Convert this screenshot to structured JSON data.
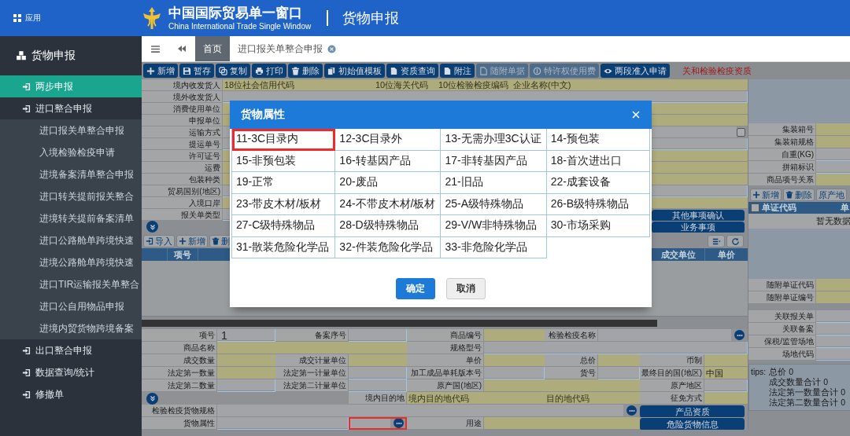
{
  "header": {
    "app_menu": "应用",
    "title": "中国国际贸易单一窗口",
    "subtitle": "China International Trade Single Window",
    "section": "货物申报"
  },
  "sidebar": {
    "title": "货物申报",
    "items": [
      {
        "label": "两步申报",
        "selected": true
      },
      {
        "label": "进口整合申报",
        "selected": false,
        "expanded": true,
        "children": [
          {
            "label": "进口报关单整合申报",
            "selected": false
          },
          {
            "label": "入境检验检疫申请",
            "selected": false
          },
          {
            "label": "进境备案清单整合申报",
            "selected": false
          },
          {
            "label": "进口转关提前报关整合",
            "selected": false
          },
          {
            "label": "进境转关提前备案清单",
            "selected": false
          },
          {
            "label": "进口公路舱单跨境快速",
            "selected": false
          },
          {
            "label": "进境公路舱单跨境快速",
            "selected": false
          },
          {
            "label": "进口TIR运输报关单整合",
            "selected": false
          },
          {
            "label": "进口公自用物品申报",
            "selected": false
          },
          {
            "label": "进境内贸货物跨境备案",
            "selected": false
          }
        ]
      },
      {
        "label": "出口整合申报",
        "selected": false
      },
      {
        "label": "数据查询/统计",
        "selected": false
      },
      {
        "label": "修撤单",
        "selected": false
      }
    ]
  },
  "tabs": [
    {
      "label": "首页",
      "selected": false,
      "closable": false
    },
    {
      "label": "进口报关单整合申报",
      "selected": true,
      "closable": true
    }
  ],
  "toolbar": {
    "buttons": [
      {
        "label": "新增",
        "disabled": false
      },
      {
        "label": "暂存",
        "disabled": false
      },
      {
        "label": "复制",
        "disabled": false
      },
      {
        "label": "打印",
        "disabled": false
      },
      {
        "label": "删除",
        "disabled": false
      },
      {
        "label": "初始值模板",
        "disabled": false
      },
      {
        "label": "资质查询",
        "disabled": false
      },
      {
        "label": "附注",
        "disabled": false
      },
      {
        "label": "随附单据",
        "disabled": true
      },
      {
        "label": "特许权使用费",
        "disabled": true
      },
      {
        "label": "两段准入申请",
        "disabled": false
      }
    ],
    "notice": "关和检验检疫资质"
  },
  "upper_form": [
    [
      {
        "kind": "label",
        "text": "境内收发货人"
      },
      {
        "kind": "req",
        "placeholder": "18位社会信用代码"
      },
      {
        "kind": "req",
        "placeholder": "10位海关代码"
      },
      {
        "kind": "req",
        "placeholder": "10位检验检疫编码"
      },
      {
        "kind": "req",
        "placeholder": "企业名称(中文)"
      }
    ],
    [
      {
        "kind": "label",
        "text": "境外收发货人"
      },
      {
        "kind": "opt"
      }
    ],
    [
      {
        "kind": "label",
        "text": "消费使用单位"
      },
      {
        "kind": "req"
      }
    ],
    [
      {
        "kind": "label",
        "text": "申报单位"
      },
      {
        "kind": "req"
      }
    ],
    [
      {
        "kind": "label",
        "text": "运输方式"
      },
      {
        "kind": "check",
        "checked": false
      }
    ],
    [
      {
        "kind": "label",
        "text": "提运单号"
      },
      {
        "kind": "opt"
      }
    ],
    [
      {
        "kind": "label",
        "text": "许可证号"
      },
      {
        "kind": "req"
      }
    ],
    [
      {
        "kind": "label",
        "text": "运费"
      },
      {
        "kind": "req"
      }
    ],
    [
      {
        "kind": "label",
        "text": "包装种类"
      },
      {
        "kind": "req"
      }
    ],
    [
      {
        "kind": "label",
        "text": "贸易国别(地区)"
      },
      {
        "kind": "opt"
      }
    ],
    [
      {
        "kind": "label",
        "text": "入境口岸"
      },
      {
        "kind": "req"
      }
    ],
    [
      {
        "kind": "label",
        "text": "报关单类型"
      },
      {
        "kind": "opt"
      },
      {
        "kind": "button",
        "text": "其他事项确认"
      }
    ],
    [
      {
        "kind": "expand"
      },
      {
        "kind": "blank"
      },
      {
        "kind": "button",
        "text": "业务事项"
      }
    ]
  ],
  "items_toolbar": {
    "buttons": [
      "导入",
      "新增",
      "删"
    ]
  },
  "items_table": {
    "columns": [
      "项号",
      "成交单位",
      "单价"
    ]
  },
  "lower_form": [
    [
      {
        "kind": "label",
        "text": "项号"
      },
      {
        "kind": "opt",
        "text": "1"
      },
      {
        "kind": "label",
        "text": "备案序号"
      },
      {
        "kind": "opt"
      },
      {
        "kind": "label",
        "text": "商品编号"
      },
      {
        "kind": "req"
      },
      {
        "kind": "label",
        "text": "检验检疫名称"
      },
      {
        "kind": "more",
        "highlighted": false
      }
    ],
    [
      {
        "kind": "label",
        "text": "商品名称"
      },
      {
        "kind": "req"
      },
      {
        "kind": "label",
        "text": "规格型号"
      },
      {
        "kind": "opt"
      }
    ],
    [
      {
        "kind": "label",
        "text": "成交数量"
      },
      {
        "kind": "req"
      },
      {
        "kind": "label",
        "text": "成交计量单位"
      },
      {
        "kind": "req"
      },
      {
        "kind": "label",
        "text": "单价"
      },
      {
        "kind": "req"
      },
      {
        "kind": "label",
        "text": "总价"
      },
      {
        "kind": "req"
      },
      {
        "kind": "label",
        "text": "币制"
      },
      {
        "kind": "req"
      }
    ],
    [
      {
        "kind": "label",
        "text": "法定第一数量"
      },
      {
        "kind": "req"
      },
      {
        "kind": "label",
        "text": "法定第一计量单位"
      },
      {
        "kind": "opt"
      },
      {
        "kind": "label",
        "text": "加工成品单耗版本号"
      },
      {
        "kind": "opt"
      },
      {
        "kind": "label",
        "text": "货号"
      },
      {
        "kind": "opt"
      },
      {
        "kind": "label",
        "text": "最终目的国(地区)"
      },
      {
        "kind": "req",
        "text": "中国"
      }
    ],
    [
      {
        "kind": "label",
        "text": "法定第二数量"
      },
      {
        "kind": "opt"
      },
      {
        "kind": "label",
        "text": "法定第二计量单位"
      },
      {
        "kind": "opt"
      },
      {
        "kind": "label",
        "text": "原产国(地区)"
      },
      {
        "kind": "req"
      },
      {
        "kind": "label",
        "text": "原产地区"
      },
      {
        "kind": "opt"
      }
    ],
    [
      {
        "kind": "expand"
      },
      {
        "kind": "blank"
      },
      {
        "kind": "label",
        "text": "境内目的地"
      },
      {
        "kind": "req",
        "placeholder": "境内目的地代码"
      },
      {
        "kind": "req",
        "placeholder": "目的地代码"
      },
      {
        "kind": "label",
        "text": "征免方式"
      },
      {
        "kind": "req"
      }
    ],
    [
      {
        "kind": "label",
        "text": "检验检疫货物规格"
      },
      {
        "kind": "more",
        "highlighted": false
      },
      {
        "kind": "button",
        "text": "产品资质"
      }
    ],
    [
      {
        "kind": "label",
        "text": "货物属性"
      },
      {
        "kind": "opt"
      },
      {
        "kind": "more",
        "highlighted": true
      },
      {
        "kind": "label",
        "text": "用途"
      },
      {
        "kind": "req"
      },
      {
        "kind": "button",
        "text": "危险货物信息"
      }
    ]
  ],
  "right_panel": {
    "container_rows": [
      {
        "label": "集装箱号",
        "kind": "req"
      },
      {
        "label": "集装箱规格",
        "kind": "req"
      },
      {
        "label": "自重(KG)",
        "kind": "opt"
      },
      {
        "label": "拼箱标识",
        "kind": "opt"
      },
      {
        "label": "商品项号关系",
        "kind": "req"
      }
    ],
    "toolbar": [
      "新增",
      "删除",
      "原产地"
    ],
    "table": {
      "checked": false,
      "columns": [
        "单证代码",
        "单"
      ],
      "empty": "暂无数据"
    },
    "doc_rows": [
      {
        "label": "随附单证代码",
        "kind": "req"
      },
      {
        "label": "随附单证编号",
        "kind": "req"
      }
    ],
    "link_rows": [
      {
        "label": "关联报关单",
        "kind": "opt"
      },
      {
        "label": "关联备案",
        "kind": "opt"
      },
      {
        "label": "保税/监管场地",
        "kind": "opt"
      },
      {
        "label": "场地代码",
        "kind": "opt"
      }
    ],
    "tips": {
      "label": "tips:",
      "lines": [
        "总价 0",
        "成交数量合计 0",
        "法定第一数量合计 0",
        "法定第二数量合计 0"
      ]
    }
  },
  "dialog": {
    "title": "货物属性",
    "options": [
      {
        "label": "11-3C目录内",
        "selected": true
      },
      {
        "label": "12-3C目录外",
        "selected": false
      },
      {
        "label": "13-无需办理3C认证",
        "selected": false
      },
      {
        "label": "14-预包装",
        "selected": false
      },
      {
        "label": "15-非预包装",
        "selected": false
      },
      {
        "label": "16-转基因产品",
        "selected": false
      },
      {
        "label": "17-非转基因产品",
        "selected": false
      },
      {
        "label": "18-首次进出口",
        "selected": false
      },
      {
        "label": "19-正常",
        "selected": false
      },
      {
        "label": "20-废品",
        "selected": false
      },
      {
        "label": "21-旧品",
        "selected": false
      },
      {
        "label": "22-成套设备",
        "selected": false
      },
      {
        "label": "23-带皮木材/板材",
        "selected": false
      },
      {
        "label": "24-不带皮木材/板材",
        "selected": false
      },
      {
        "label": "25-A级特殊物品",
        "selected": false
      },
      {
        "label": "26-B级特殊物品",
        "selected": false
      },
      {
        "label": "27-C级特殊物品",
        "selected": false
      },
      {
        "label": "28-D级特殊物品",
        "selected": false
      },
      {
        "label": "29-V/W非特殊物品",
        "selected": false
      },
      {
        "label": "30-市场采购",
        "selected": false
      },
      {
        "label": "31-散装危险化学品",
        "selected": false
      },
      {
        "label": "32-件装危险化学品",
        "selected": false
      },
      {
        "label": "33-非危险化学品",
        "selected": false
      }
    ],
    "buttons": [
      {
        "label": "确定",
        "kind": "primary"
      },
      {
        "label": "取消",
        "kind": "default"
      }
    ]
  }
}
